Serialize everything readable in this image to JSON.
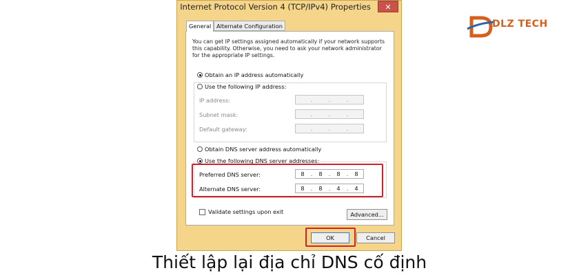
{
  "window": {
    "title": "Internet Protocol Version 4 (TCP/IPv4) Properties",
    "close_glyph": "✕"
  },
  "tabs": [
    {
      "label": "General",
      "active": true
    },
    {
      "label": "Alternate Configuration",
      "active": false
    }
  ],
  "description": "You can get IP settings assigned automatically if your network supports this capability. Otherwise, you need to ask your network administrator for the appropriate IP settings.",
  "ip_section": {
    "auto_label": "Obtain an IP address automatically",
    "auto_checked": true,
    "manual_label": "Use the following IP address:",
    "manual_checked": false,
    "fields": [
      {
        "label": "IP address:",
        "octets": [
          "",
          "",
          "",
          ""
        ]
      },
      {
        "label": "Subnet mask:",
        "octets": [
          "",
          "",
          "",
          ""
        ]
      },
      {
        "label": "Default gateway:",
        "octets": [
          "",
          "",
          "",
          ""
        ]
      }
    ]
  },
  "dns_section": {
    "auto_label": "Obtain DNS server address automatically",
    "auto_checked": false,
    "manual_label": "Use the following DNS server addresses:",
    "manual_checked": true,
    "preferred": {
      "label": "Preferred DNS server:",
      "octets": [
        "8",
        "8",
        "8",
        "8"
      ]
    },
    "alternate": {
      "label": "Alternate DNS server:",
      "octets": [
        "8",
        "8",
        "4",
        "4"
      ]
    }
  },
  "validate_label": "Validate settings upon exit",
  "validate_checked": false,
  "buttons": {
    "advanced": "Advanced...",
    "ok": "OK",
    "cancel": "Cancel"
  },
  "caption": "Thiết lập lại địa chỉ DNS cố định",
  "logo": {
    "text": "DLZ TECH"
  },
  "colors": {
    "dialog_frame": "#f4d58a",
    "highlight": "#d21f2a",
    "logo": "#d4601c",
    "close_button": "#c9524a"
  }
}
